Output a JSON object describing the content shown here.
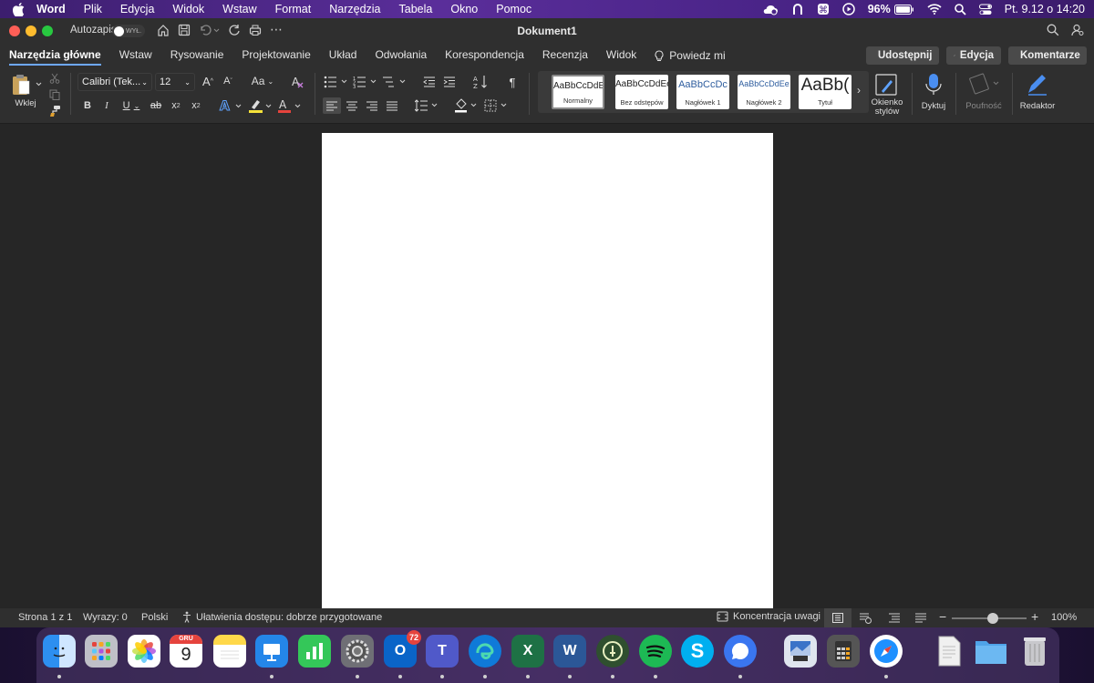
{
  "menubar": {
    "app_name": "Word",
    "items": [
      "Plik",
      "Edycja",
      "Widok",
      "Wstaw",
      "Format",
      "Narzędzia",
      "Tabela",
      "Okno",
      "Pomoc"
    ],
    "battery": "96%",
    "datetime": "Pt. 9.12 o  14:20"
  },
  "titlebar": {
    "autosave_label": "Autozapis",
    "autosave_state": "WYŁ.",
    "document_title": "Dokument1"
  },
  "tabs": [
    "Narzędzia główne",
    "Wstaw",
    "Rysowanie",
    "Projektowanie",
    "Układ",
    "Odwołania",
    "Korespondencja",
    "Recenzja",
    "Widok"
  ],
  "tell_me": "Powiedz mi",
  "header_buttons": {
    "share": "Udostępnij",
    "editing": "Edycja",
    "comments": "Komentarze"
  },
  "ribbon": {
    "paste_label": "Wklej",
    "font_name": "Calibri (Tek...",
    "font_size": "12",
    "styles": [
      {
        "sample": "AaBbCcDdEe",
        "name": "Normalny"
      },
      {
        "sample": "AaBbCcDdEe",
        "name": "Bez odstępów"
      },
      {
        "sample": "AaBbCcDc",
        "name": "Nagłówek 1"
      },
      {
        "sample": "AaBbCcDdEe",
        "name": "Nagłówek 2"
      },
      {
        "sample": "AaBb(",
        "name": "Tytuł"
      }
    ],
    "styles_pane_label": "Okienko stylów",
    "dictate_label": "Dyktuj",
    "sensitivity_label": "Poufność",
    "editor_label": "Redaktor"
  },
  "statusbar": {
    "page": "Strona 1 z 1",
    "words": "Wyrazy: 0",
    "language": "Polski",
    "accessibility": "Ułatwienia dostępu: dobrze przygotowane",
    "focus": "Koncentracja uwagi",
    "zoom": "100%",
    "zoom_fraction": 0.55
  },
  "dock": {
    "calendar_month": "GRU",
    "calendar_day": "9",
    "outlook_badge": "72",
    "skype_letter": "S"
  },
  "colors": {
    "accent": "#6ea8ff",
    "menubar": "#4a2488",
    "highlight": "#f5e23a",
    "font_color": "#e5433d"
  }
}
